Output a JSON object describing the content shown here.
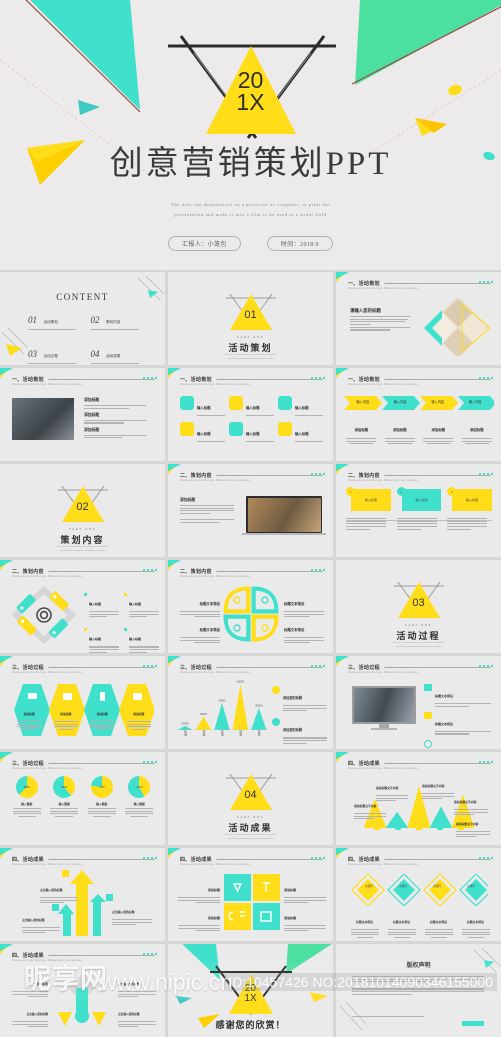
{
  "hero": {
    "year_top": "20",
    "year_bottom": "1X",
    "title": "创意营销策划PPT",
    "subtitle_line1": "The user can demonstrate  on a projector  or computer,  or print the",
    "subtitle_line2": "presentation  and make it  into a film to be used in a wider field",
    "pill_presenter": "汇报人：小笼包",
    "pill_date": "时间：2018.9"
  },
  "colors": {
    "yellow": "#FFDD18",
    "cyan": "#3FE0CC",
    "green": "#4BE0A0",
    "bg": "#ebeaea",
    "page_bg": "#d9d9d9",
    "text_dark": "#2f2f2f",
    "text_muted": "#9c9c9c"
  },
  "watermark": {
    "logo": "昵享网",
    "url": "www.nipic.cn",
    "id_text": "ID:10457426 NO:20181014090346155000"
  },
  "content_slide": {
    "title": "CONTENT",
    "items": [
      {
        "num": "01",
        "label": "活动策划"
      },
      {
        "num": "02",
        "label": "策划内容"
      },
      {
        "num": "03",
        "label": "活动过程"
      },
      {
        "num": "04",
        "label": "活动成果"
      }
    ]
  },
  "section_dividers": [
    {
      "num": "01",
      "part": "PART ONE",
      "cn": "活动策划"
    },
    {
      "num": "02",
      "part": "PART ONE",
      "cn": "策划内容"
    },
    {
      "num": "03",
      "part": "PART ONE",
      "cn": "活动过程"
    },
    {
      "num": "04",
      "part": "PART ONE",
      "cn": "活动成果"
    }
  ],
  "headers": {
    "h1": "一、活动策划",
    "h2": "二、策划内容",
    "h3": "三、活动过程",
    "h4": "四、活动成果",
    "sub": "Please enter your title here. Please enter your title here."
  },
  "common_labels": {
    "input_title": "输入标题",
    "input_content": "输入内容",
    "add_title": "添加标题",
    "enter_your_title": "请输入您的标题",
    "text_title": "标题文本预设",
    "click_add": "点击输入您的标题",
    "result_title": "添加标题文字内容",
    "activity": "关键词"
  },
  "slides": [
    {
      "id": 1,
      "kind": "content",
      "header": ""
    },
    {
      "id": 2,
      "kind": "divider",
      "divider": 0
    },
    {
      "id": 3,
      "kind": "title-image",
      "header": "一、活动策划",
      "title": "请输入您的标题"
    },
    {
      "id": 4,
      "kind": "photo-text",
      "header": "一、活动策划",
      "title": "添加您的标题"
    },
    {
      "id": 5,
      "kind": "icon-grid-6",
      "header": "一、活动策划",
      "title": "输入标题"
    },
    {
      "id": 6,
      "kind": "arrow-flow-4",
      "header": "一、活动策划",
      "title": "输入内容"
    },
    {
      "id": 7,
      "kind": "divider",
      "divider": 1
    },
    {
      "id": 8,
      "kind": "laptop-text",
      "header": "二、策划内容",
      "title": "添加您的标题"
    },
    {
      "id": 9,
      "kind": "cards-3",
      "header": "二、策划内容",
      "title": "请输入标题"
    },
    {
      "id": 10,
      "kind": "tags-diamond",
      "header": "二、策划内容",
      "title": "输入标题内容"
    },
    {
      "id": 11,
      "kind": "four-leaf",
      "header": "二、策划内容",
      "title": "标题文本预设"
    },
    {
      "id": 12,
      "kind": "divider",
      "divider": 2
    },
    {
      "id": 13,
      "kind": "hexagons-4",
      "header": "三、活动过程",
      "title": "添加您的标题"
    },
    {
      "id": 14,
      "kind": "chart",
      "header": "三、活动过程",
      "title": "添加您的标题"
    },
    {
      "id": 15,
      "kind": "monitor-list",
      "header": "三、活动过程",
      "title": "标题文字描述"
    },
    {
      "id": 16,
      "kind": "pies-4",
      "header": "三、活动过程",
      "title": "输入数据"
    },
    {
      "id": 17,
      "kind": "divider",
      "divider": 3
    },
    {
      "id": 18,
      "kind": "mountains",
      "header": "四、活动成果",
      "title": "输入成果标题"
    },
    {
      "id": 19,
      "kind": "arrows-up",
      "header": "四、活动成果",
      "title": "点击输入您的标题"
    },
    {
      "id": 20,
      "kind": "squares-4",
      "header": "四、活动成果",
      "title": "添加标题"
    },
    {
      "id": 21,
      "kind": "diamonds-4",
      "header": "四、活动成果",
      "title": "关键词"
    },
    {
      "id": 22,
      "kind": "center-4",
      "header": "四、活动成果",
      "title": "点击输入您的标题"
    },
    {
      "id": 23,
      "kind": "thanks",
      "thanks": "感谢您的欣赏！"
    },
    {
      "id": 24,
      "kind": "copyright",
      "title": "版权声明"
    }
  ],
  "chart_data": {
    "type": "bar",
    "title": "添加您的标题",
    "categories": [
      "标题",
      "标题",
      "标题",
      "标题",
      "标题"
    ],
    "values": [
      8,
      26,
      52,
      88,
      42
    ],
    "value_labels": [
      "00000",
      "00000",
      "00000",
      "00000",
      "00000"
    ],
    "series_colors": [
      "#3FE0CC",
      "#FFDD18",
      "#3FE0CC",
      "#FFDD18",
      "#3FE0CC"
    ],
    "xlabel": "",
    "ylabel": "",
    "ylim": [
      0,
      100
    ],
    "grid": false,
    "legend": [
      "添加您的标题",
      "添加您的标题"
    ]
  },
  "pie_data": {
    "type": "pie",
    "charts": [
      {
        "label": "输入数据",
        "value": 63,
        "display": "63%"
      },
      {
        "label": "输入数据",
        "value": 39,
        "display": "39%"
      },
      {
        "label": "输入数据",
        "value": 77,
        "display": "77%"
      },
      {
        "label": "输入数据",
        "value": 42,
        "display": "42%"
      }
    ],
    "colors": [
      "#FFDD18",
      "#3FE0CC"
    ]
  },
  "mountain_data": {
    "type": "area",
    "values": [
      55,
      30,
      78,
      40,
      62
    ],
    "colors": [
      "#FFDD18",
      "#3FE0CC",
      "#FFDD18",
      "#3FE0CC",
      "#FFDD18"
    ],
    "labels": [
      "输入成果标题",
      "输入成果标题",
      "输入成果标题",
      "输入成果标题",
      "输入成果标题"
    ]
  },
  "copyright_slide": {
    "title": "版权声明",
    "para1": "感谢您下载平台上提供的PPT作品，为了您和平台以及原创作者的利益，请勿复制、传播、销售，否则将承担法律责任！将对作品进行维权，按照传播下载次数进行十倍的索取赔偿！",
    "para2": "1、在平台上享有所有作品的著作权；2、作品仅供个人学习交流使用，严禁转载、售卖；3、严禁在商业活动中使用。"
  }
}
